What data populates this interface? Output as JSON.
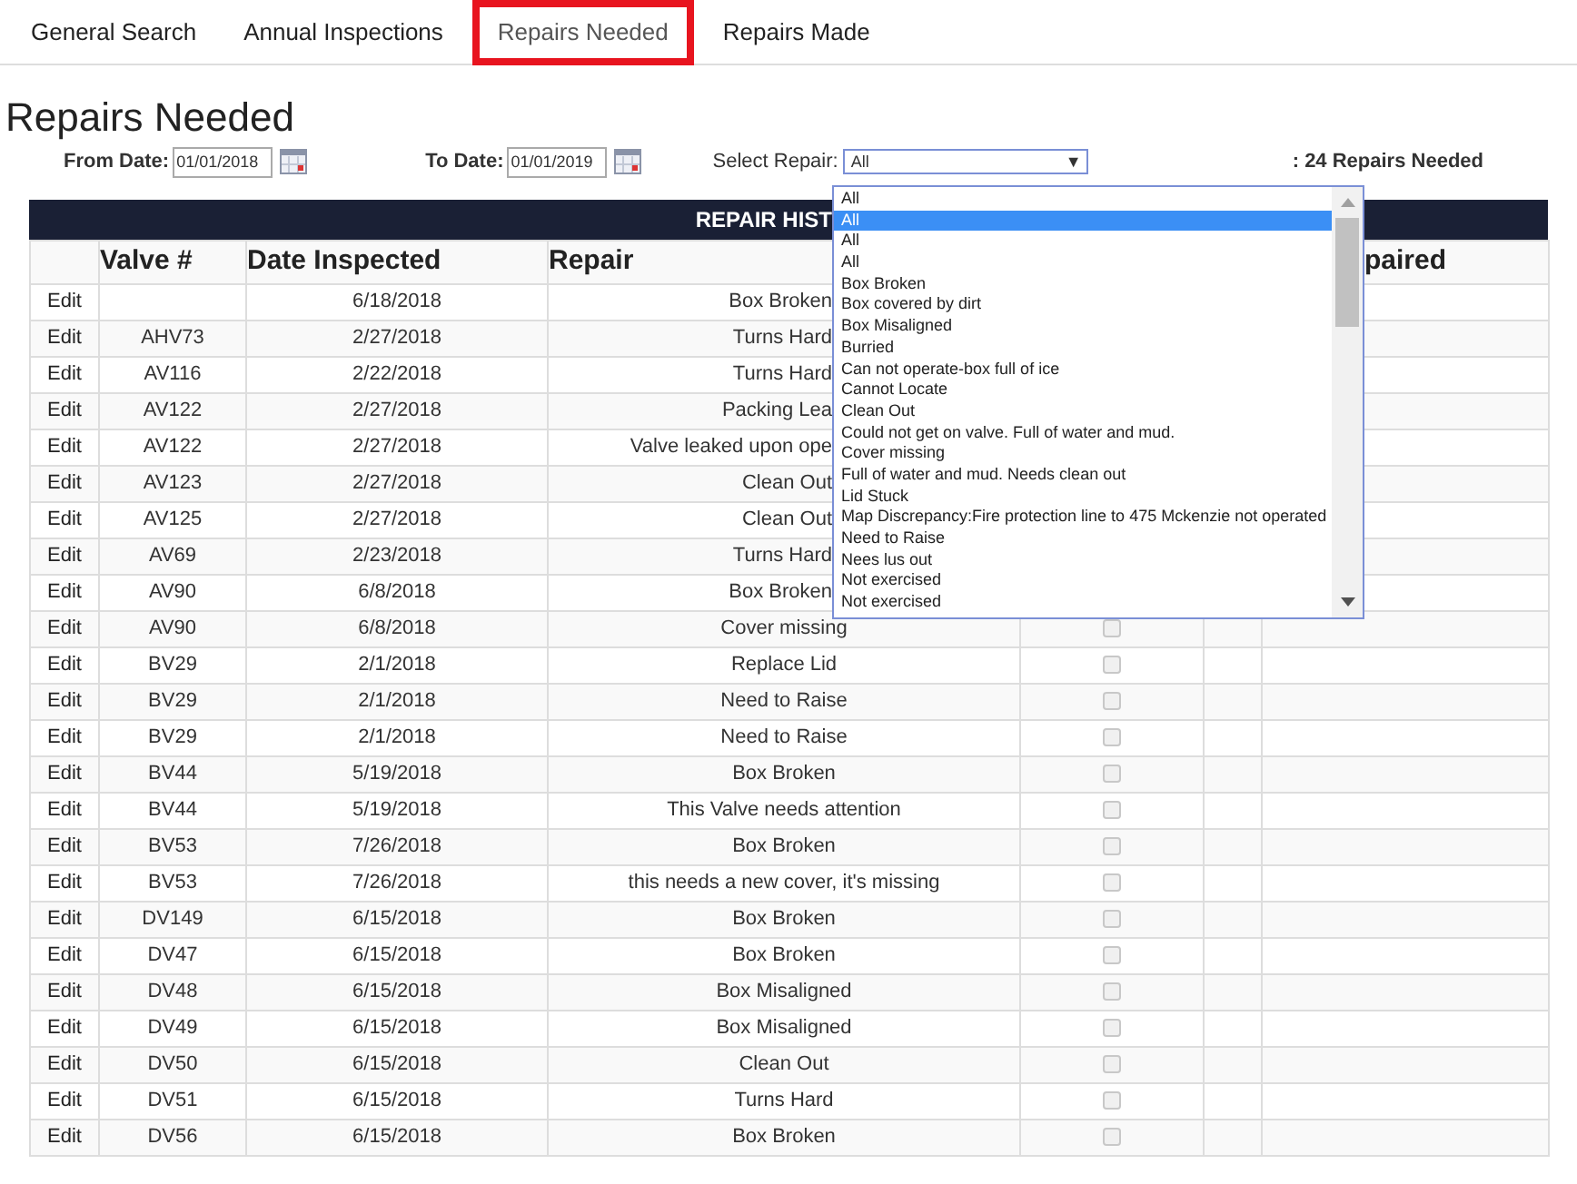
{
  "tabs": [
    {
      "label": "General Search",
      "selected": false
    },
    {
      "label": "Annual Inspections",
      "selected": false
    },
    {
      "label": "Repairs Needed",
      "selected": true
    },
    {
      "label": "Repairs Made",
      "selected": false
    }
  ],
  "title": "Repairs Needed",
  "filters": {
    "from_label": "From Date:",
    "from_value": "01/01/2018",
    "to_label": "To Date:",
    "to_value": "01/01/2019",
    "repair_label": "Select Repair:",
    "repair_value": "All",
    "caret": "▼",
    "count": ": 24 Repairs Needed"
  },
  "dropdown": {
    "open": true,
    "options": [
      {
        "label": "All",
        "selected": false
      },
      {
        "label": "All",
        "selected": true
      },
      {
        "label": "All",
        "selected": false
      },
      {
        "label": "All",
        "selected": false
      },
      {
        "label": "Box Broken",
        "selected": false
      },
      {
        "label": "Box covered by dirt",
        "selected": false
      },
      {
        "label": "Box Misaligned",
        "selected": false
      },
      {
        "label": "Burried",
        "selected": false
      },
      {
        "label": "Can not operate-box full of ice",
        "selected": false
      },
      {
        "label": "Cannot Locate",
        "selected": false
      },
      {
        "label": "Clean Out",
        "selected": false
      },
      {
        "label": "Could not get on valve. Full of water and mud.",
        "selected": false
      },
      {
        "label": "Cover missing",
        "selected": false
      },
      {
        "label": "Full of water and mud. Needs clean out",
        "selected": false
      },
      {
        "label": "Lid Stuck",
        "selected": false
      },
      {
        "label": "Map Discrepancy:Fire protection line to 475 Mckenzie not operated",
        "selected": false
      },
      {
        "label": "Need to Raise",
        "selected": false
      },
      {
        "label": "Nees lus out",
        "selected": false
      },
      {
        "label": "Not exercised",
        "selected": false
      },
      {
        "label": "Not exercised",
        "selected": false
      }
    ]
  },
  "table": {
    "title": "REPAIR HIST",
    "columns": {
      "valve": "Valve #",
      "date": "Date Inspected",
      "repair": "Repair",
      "column_7": "paired"
    },
    "rows": [
      {
        "action": "Edit",
        "date": "6/18/2018",
        "repair": "Box Broken"
      },
      {
        "action": "Edit",
        "valve": "AHV73",
        "date": "2/27/2018",
        "repair": "Turns Hard"
      },
      {
        "action": "Edit",
        "valve": "AV116",
        "date": "2/22/2018",
        "repair": "Turns Hard"
      },
      {
        "action": "Edit",
        "valve": "AV122",
        "date": "2/27/2018",
        "repair": "Packing Lea"
      },
      {
        "action": "Edit",
        "valve": "AV122",
        "date": "2/27/2018",
        "repair": "Valve leaked upon ope"
      },
      {
        "action": "Edit",
        "valve": "AV123",
        "date": "2/27/2018",
        "repair": "Clean Out"
      },
      {
        "action": "Edit",
        "valve": "AV125",
        "date": "2/27/2018",
        "repair": "Clean Out"
      },
      {
        "action": "Edit",
        "valve": "AV69",
        "date": "2/23/2018",
        "repair": "Turns Hard"
      },
      {
        "action": "Edit",
        "valve": "AV90",
        "date": "6/8/2018",
        "repair": "Box Broken"
      },
      {
        "action": "Edit",
        "valve": "AV90",
        "date": "6/8/2018",
        "repair": "Cover missing",
        "checked": false
      },
      {
        "action": "Edit",
        "valve": "BV29",
        "date": "2/1/2018",
        "repair": "Replace Lid",
        "checked": false
      },
      {
        "action": "Edit",
        "valve": "BV29",
        "date": "2/1/2018",
        "repair": "Need to Raise",
        "checked": false
      },
      {
        "action": "Edit",
        "valve": "BV29",
        "date": "2/1/2018",
        "repair": "Need to Raise",
        "checked": false
      },
      {
        "action": "Edit",
        "valve": "BV44",
        "date": "5/19/2018",
        "repair": "Box Broken",
        "checked": false
      },
      {
        "action": "Edit",
        "valve": "BV44",
        "date": "5/19/2018",
        "repair": "This Valve needs attention",
        "checked": false
      },
      {
        "action": "Edit",
        "valve": "BV53",
        "date": "7/26/2018",
        "repair": "Box Broken",
        "checked": false
      },
      {
        "action": "Edit",
        "valve": "BV53",
        "date": "7/26/2018",
        "repair": "this needs a new cover, it's missing",
        "checked": false
      },
      {
        "action": "Edit",
        "valve": "DV149",
        "date": "6/15/2018",
        "repair": "Box Broken",
        "checked": false
      },
      {
        "action": "Edit",
        "valve": "DV47",
        "date": "6/15/2018",
        "repair": "Box Broken",
        "checked": false
      },
      {
        "action": "Edit",
        "valve": "DV48",
        "date": "6/15/2018",
        "repair": "Box Misaligned",
        "checked": false
      },
      {
        "action": "Edit",
        "valve": "DV49",
        "date": "6/15/2018",
        "repair": "Box Misaligned",
        "checked": false
      },
      {
        "action": "Edit",
        "valve": "DV50",
        "date": "6/15/2018",
        "repair": "Clean Out",
        "checked": false
      },
      {
        "action": "Edit",
        "valve": "DV51",
        "date": "6/15/2018",
        "repair": "Turns Hard",
        "checked": false
      },
      {
        "action": "Edit",
        "valve": "DV56",
        "date": "6/15/2018",
        "repair": "Box Broken",
        "checked": false
      }
    ]
  }
}
